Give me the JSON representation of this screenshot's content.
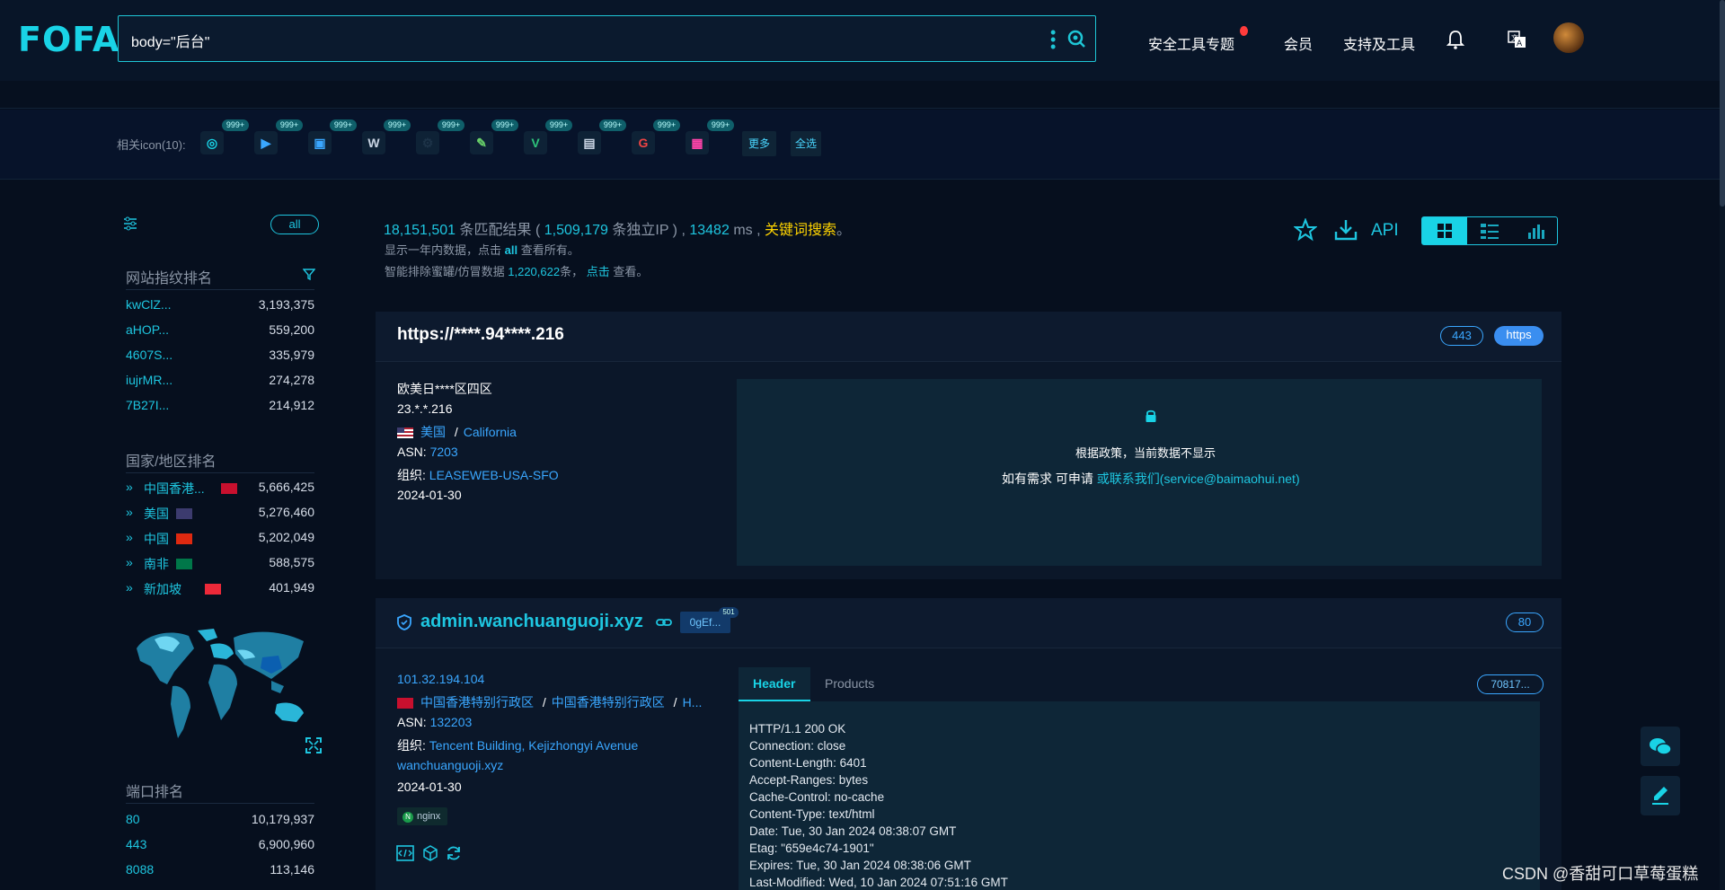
{
  "header": {
    "logo": "FOFA",
    "query": "body=\"后台\"",
    "nav": [
      "安全工具专题",
      "会员",
      "支持及工具"
    ]
  },
  "icon_strip": {
    "label": "相关icon(10):",
    "badge": "999+",
    "more": "更多",
    "select_all": "全选",
    "icons": [
      "fofa-icon",
      "play-icon",
      "frame-icon",
      "wordpress-icon",
      "gear-icon",
      "leaf-icon",
      "vue-icon",
      "doc-icon",
      "google-icon",
      "windows-icon"
    ]
  },
  "stats": {
    "total": "18,151,501",
    "total_label": "条匹配结果 (",
    "ips": "1,509,179",
    "ips_label": "条独立IP ) ,",
    "ms": "13482",
    "ms_label": "ms ,",
    "keyword": "关键词搜索",
    "period": "。",
    "note1_pre": "显示一年内数据，点击",
    "note1_all": "all",
    "note1_post": "查看所有。",
    "note2_pre": "智能排除蜜罐/仿冒数据",
    "note2_num": "1,220,622",
    "note2_mid": "条，",
    "note2_click": "点击",
    "note2_post": "查看。",
    "api": "API"
  },
  "left": {
    "all": "all",
    "fingerprint_title": "网站指纹排名",
    "fingerprints": [
      {
        "k": "kwClZ...",
        "v": "3,193,375"
      },
      {
        "k": "aHOP...",
        "v": "559,200"
      },
      {
        "k": "4607S...",
        "v": "335,979"
      },
      {
        "k": "iujrMR...",
        "v": "274,278"
      },
      {
        "k": "7B27I...",
        "v": "214,912"
      }
    ],
    "country_title": "国家/地区排名",
    "countries": [
      {
        "k": "中国香港...",
        "v": "5,666,425",
        "flag": "#c8102e"
      },
      {
        "k": "美国",
        "v": "5,276,460",
        "flag": "#3c3b6e"
      },
      {
        "k": "中国",
        "v": "5,202,049",
        "flag": "#de2910"
      },
      {
        "k": "南非",
        "v": "588,575",
        "flag": "#007749"
      },
      {
        "k": "新加坡",
        "v": "401,949",
        "flag": "#ed2939"
      }
    ],
    "port_title": "端口排名",
    "ports": [
      {
        "k": "80",
        "v": "10,179,937"
      },
      {
        "k": "443",
        "v": "6,900,960"
      },
      {
        "k": "8088",
        "v": "113,146"
      }
    ]
  },
  "result1": {
    "title": "https://****.94****.216",
    "port": "443",
    "proto": "https",
    "org_name": "欧美日****区四区",
    "ip": "23.*.*.216",
    "country": "美国",
    "sep": "/",
    "region": "California",
    "asn_label": "ASN:",
    "asn": "7203",
    "org_label": "组织:",
    "org": "LEASEWEB-USA-SFO",
    "date": "2024-01-30",
    "policy": "根据政策，当前数据不显示",
    "apply_pre": "如有需求 可申请",
    "apply_link": "或联系我们(service@baimaohui.net)"
  },
  "result2": {
    "title": "admin.wanchuanguoji.xyz",
    "tag": "0gEf...",
    "tag_count": "501",
    "port": "80",
    "ip": "101.32.194.104",
    "region1": "中国香港特别行政区",
    "sep": "/",
    "region2": "中国香港特别行政区",
    "region3": "H...",
    "asn_label": "ASN:",
    "asn": "132203",
    "org_label": "组织:",
    "org": "Tencent Building, Kejizhongyi Avenue",
    "domain": "wanchuanguoji.xyz",
    "date": "2024-01-30",
    "server": "nginx",
    "tab_header": "Header",
    "tab_products": "Products",
    "hash": "70817...",
    "http_lines": [
      "HTTP/1.1 200 OK",
      "Connection: close",
      "Content-Length: 6401",
      "Accept-Ranges: bytes",
      "Cache-Control: no-cache",
      "Content-Type: text/html",
      "Date: Tue, 30 Jan 2024 08:38:07 GMT",
      "Etag: \"659e4c74-1901\"",
      "Expires: Tue, 30 Jan 2024 08:38:06 GMT",
      "Last-Modified: Wed, 10 Jan 2024 07:51:16 GMT"
    ]
  },
  "watermark": "CSDN @香甜可口草莓蛋糕",
  "colors": {
    "accent": "#19d3e6",
    "link": "#3aa7ff",
    "highlight": "#ffd400"
  }
}
